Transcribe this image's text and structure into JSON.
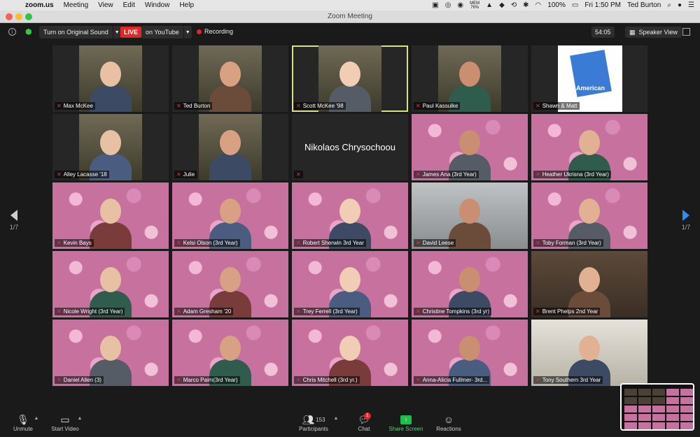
{
  "menubar": {
    "app_name": "zoom.us",
    "menus": [
      "Meeting",
      "View",
      "Edit",
      "Window",
      "Help"
    ],
    "mem_label": "MEM",
    "mem_value": "76%",
    "battery": "100%",
    "datetime": "Fri 1:50 PM",
    "user": "Ted Burton"
  },
  "window": {
    "title": "Zoom Meeting"
  },
  "topbar": {
    "audio_button": "Turn on Original Sound",
    "live_badge": "LIVE",
    "live_target": "on YouTube",
    "recording": "Recording",
    "timer": "54:05",
    "view_mode": "Speaker View"
  },
  "participants": [
    {
      "name": "Max McKee",
      "bg": "dark"
    },
    {
      "name": "Ted Burton",
      "bg": "dark"
    },
    {
      "name": "Scott McKee '98",
      "bg": "dark",
      "active": true
    },
    {
      "name": "Paul Kassulke",
      "bg": "dark"
    },
    {
      "name": "Shawn & Matt",
      "bg": "dark"
    },
    {
      "name": "Alley Lacasse '18",
      "bg": "dark"
    },
    {
      "name": "Julie",
      "bg": "dark"
    },
    {
      "name": "Nikolaos Chrysochoou",
      "bg": "dark",
      "no_video": true
    },
    {
      "name": "James Ana (3rd Year)",
      "bg": "pink"
    },
    {
      "name": "Heather Ukrisna (3rd Year)",
      "bg": "pink"
    },
    {
      "name": "Kevin Bays",
      "bg": "pink"
    },
    {
      "name": "Kelsi Olson (3rd Year)",
      "bg": "pink"
    },
    {
      "name": "Robert Sherwin 3rd Year",
      "bg": "pink"
    },
    {
      "name": "David Leese",
      "bg": "gray"
    },
    {
      "name": "Toby Forman (3rd Year)",
      "bg": "pink"
    },
    {
      "name": "Nicole Wright (3rd Year)",
      "bg": "pink"
    },
    {
      "name": "Adam Gresham '20",
      "bg": "pink"
    },
    {
      "name": "Trey Ferrell (3rd Year)",
      "bg": "pink"
    },
    {
      "name": "Christine Tompkins (3rd yr)",
      "bg": "pink"
    },
    {
      "name": "Brent Phelps 2nd Year",
      "bg": "warm"
    },
    {
      "name": "Daniel Allen (3)",
      "bg": "pink"
    },
    {
      "name": "Marco Paim(3rd Year)",
      "bg": "pink"
    },
    {
      "name": "Chris Mitchell (3rd yr.)",
      "bg": "pink"
    },
    {
      "name": "Anna-Alicia Fullmer- 3rd...",
      "bg": "pink"
    },
    {
      "name": "Tony Southern 3rd Year",
      "bg": "light"
    }
  ],
  "shawn_logo_text": "American",
  "pager": {
    "left": "1/7",
    "right": "1/7"
  },
  "bottombar": {
    "unmute": "Unmute",
    "start_video": "Start Video",
    "participants_label": "Participants",
    "participants_count": "153",
    "chat_label": "Chat",
    "chat_badge": "1",
    "share_label": "Share Screen",
    "reactions_label": "Reactions"
  },
  "colors": {
    "accent_blue": "#2d8cff",
    "live_red": "#e02828",
    "share_green": "#1fbf4a",
    "active_speaker": "#d8e27a"
  }
}
